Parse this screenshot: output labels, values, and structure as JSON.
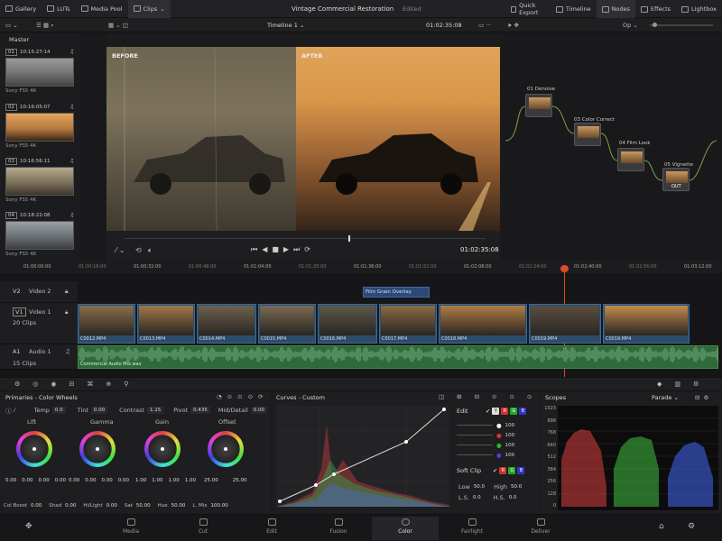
{
  "topbar": {
    "items": [
      {
        "label": "Gallery",
        "icon": "gallery-icon"
      },
      {
        "label": "LUTs",
        "icon": "luts-icon"
      },
      {
        "label": "Media Pool",
        "icon": "media-pool-icon"
      },
      {
        "label": "Clips",
        "icon": "clips-icon"
      }
    ],
    "project_title": "Vintage Commercial Restoration",
    "project_status": "Edited",
    "right_items": [
      {
        "label": "Quick Export"
      },
      {
        "label": "Timeline"
      },
      {
        "label": "Nodes"
      },
      {
        "label": "Effects"
      },
      {
        "label": "Lightbox"
      }
    ]
  },
  "subbar": {
    "timeline_name": "Timeline 1",
    "timecode": "01:02:35:08",
    "node_mode": "Op"
  },
  "media": {
    "bin": "Master",
    "clips": [
      {
        "num": "01",
        "tc": "10:15:27:14",
        "cam": "Sony FS5 4K"
      },
      {
        "num": "02",
        "tc": "10:16:05:07",
        "cam": "Sony FS5 4K"
      },
      {
        "num": "03",
        "tc": "10:16:56:11",
        "cam": "Sony FS5 4K"
      },
      {
        "num": "04",
        "tc": "10:18:22:08",
        "cam": "Sony FS5 4K"
      }
    ]
  },
  "viewer": {
    "before_label": "BEFORE",
    "after_label": "AFTER",
    "timecode": "01:02:35:08"
  },
  "nodes": [
    {
      "label": "01 Denoise"
    },
    {
      "label": "03 Color Correct"
    },
    {
      "label": "04 Film Look"
    },
    {
      "label": "05 Vignette",
      "tag": "OUT"
    }
  ],
  "ruler": [
    "01:00:00:00",
    "01:00:16:00",
    "01:00:32:00",
    "01:00:48:00",
    "01:01:04:00",
    "01:01:20:00",
    "01:01:36:00",
    "01:01:52:00",
    "01:02:08:00",
    "01:02:24:00",
    "01:02:40:00",
    "01:02:56:00",
    "01:03:12:00"
  ],
  "tracks": {
    "v2": {
      "id": "V2",
      "name": "Video 2",
      "clip": "Film Grain Overlay"
    },
    "v1": {
      "id": "V1",
      "name": "Video 1",
      "count": "20 Clips"
    },
    "a1": {
      "id": "A1",
      "name": "Audio 1",
      "count": "15 Clips",
      "clip": "Commercial Audio Mix.wav"
    },
    "clips": [
      "C0012.MP4",
      "C0013.MP4",
      "C0014.MP4",
      "C0015.MP4",
      "C0016.MP4",
      "C0017.MP4",
      "C0018.MP4",
      "C0019.MP4",
      "C0019.MP4"
    ]
  },
  "primaries": {
    "title": "Primaries - Color Wheels",
    "temp_label": "Temp",
    "temp": "0.0",
    "tint_label": "Tint",
    "tint": "0.00",
    "contrast_label": "Contrast",
    "contrast": "1.15",
    "pivot_label": "Pivot",
    "pivot": "0.435",
    "middetail_label": "Mid/Detail",
    "middetail": "0.00",
    "wheels": [
      {
        "name": "Lift",
        "vals": [
          "0.00",
          "0.00",
          "0.00",
          "0.00"
        ]
      },
      {
        "name": "Gamma",
        "vals": [
          "0.00",
          "0.00",
          "0.00",
          "0.00"
        ]
      },
      {
        "name": "Gain",
        "vals": [
          "1.00",
          "1.00",
          "1.00",
          "1.00"
        ]
      },
      {
        "name": "Offset",
        "vals": [
          "25.00",
          "25.00"
        ]
      }
    ],
    "footer": [
      {
        "label": "Col Boost",
        "val": "0.00"
      },
      {
        "label": "Shad",
        "val": "0.00"
      },
      {
        "label": "Hi/Light",
        "val": "0.00"
      },
      {
        "label": "Sat",
        "val": "50.00"
      },
      {
        "label": "Hue",
        "val": "50.00"
      },
      {
        "label": "L. Mix",
        "val": "100.00"
      }
    ]
  },
  "curves": {
    "title": "Curves - Custom",
    "edit_label": "Edit",
    "edit_vals": [
      "100",
      "100",
      "100",
      "100"
    ],
    "softclip_label": "Soft Clip",
    "low_label": "Low",
    "low": "50.0",
    "high_label": "High",
    "high": "50.0",
    "ls_label": "L.S.",
    "ls": "0.0",
    "hs_label": "H.S.",
    "hs": "0.0"
  },
  "scopes": {
    "title": "Scopes",
    "mode": "Parade",
    "scale": [
      "1023",
      "896",
      "768",
      "640",
      "512",
      "384",
      "256",
      "128",
      "0"
    ]
  },
  "pages": [
    "Media",
    "Cut",
    "Edit",
    "Fusion",
    "Color",
    "Fairlight",
    "Deliver"
  ]
}
